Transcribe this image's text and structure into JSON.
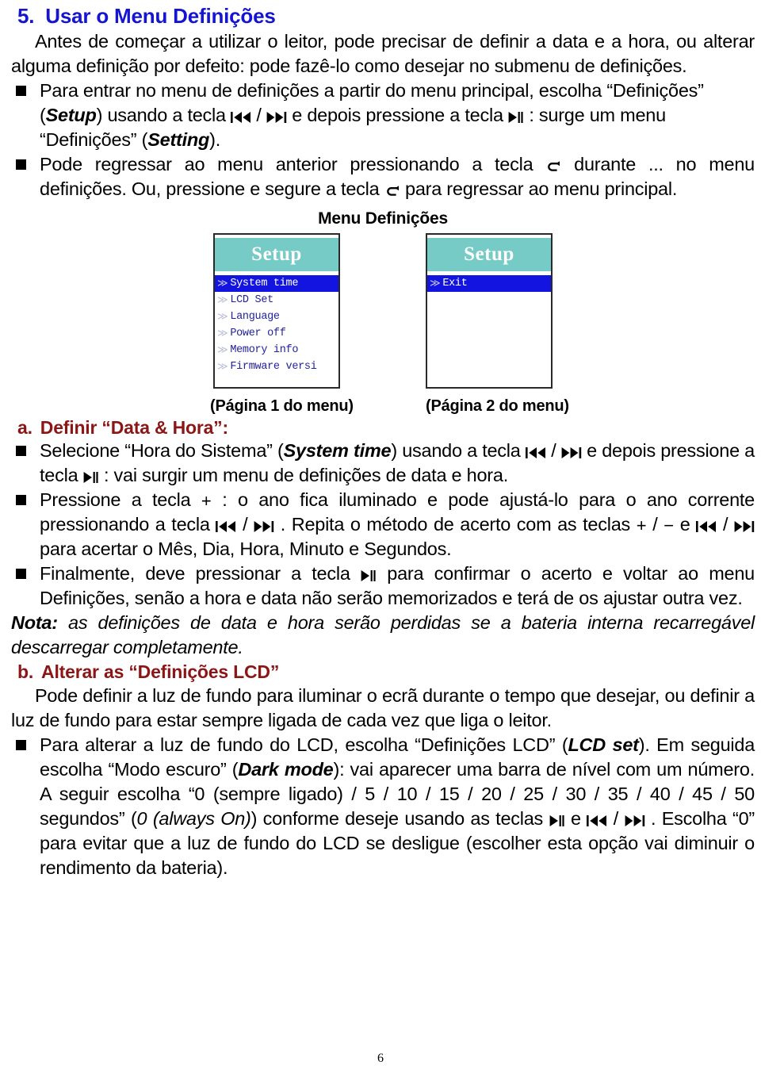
{
  "document": {
    "page_number": "6",
    "language": "pt-PT"
  },
  "section": {
    "number": "5.",
    "title": "Usar o Menu Definições",
    "color": "#1414d2",
    "intro": "Antes de começar a utilizar o leitor, pode precisar de definir a data e a hora, ou alterar alguma definição por defeito: pode fazê-lo como desejar no submenu de definições."
  },
  "bullets_intro": [
    {
      "id": "enter-setup-menu",
      "parts": [
        {
          "t": "text",
          "v": "Para entrar no menu de definições a partir do menu principal, escolha “Definições” ("
        },
        {
          "t": "bold-italic",
          "v": "Setup"
        },
        {
          "t": "text",
          "v": ") usando a tecla "
        },
        {
          "t": "key",
          "v": "prev-track"
        },
        {
          "t": "text",
          "v": " / "
        },
        {
          "t": "key",
          "v": "next-track"
        },
        {
          "t": "text",
          "v": " e depois pressione a tecla "
        },
        {
          "t": "key",
          "v": "play-pause"
        },
        {
          "t": "text",
          "v": " : surge um menu “Definições” ("
        },
        {
          "t": "bold-italic",
          "v": "Setting"
        },
        {
          "t": "text",
          "v": ")."
        }
      ]
    },
    {
      "id": "return-previous-menu",
      "parts": [
        {
          "t": "text",
          "v": "Pode regressar ao menu anterior pressionando a tecla "
        },
        {
          "t": "key",
          "v": "return-arrow"
        },
        {
          "t": "text",
          "v": " durante ... no menu definições. Ou, pressione e segure a tecla "
        },
        {
          "t": "key",
          "v": "return-arrow"
        },
        {
          "t": "text",
          "v": " para regressar ao menu principal."
        }
      ]
    }
  ],
  "figure": {
    "title": "Menu Definições",
    "screens": [
      {
        "header": "Setup",
        "caption": "(Página 1 do menu)",
        "items": [
          {
            "label": "System time",
            "selected": true
          },
          {
            "label": "LCD Set",
            "selected": false
          },
          {
            "label": "Language",
            "selected": false
          },
          {
            "label": "Power off",
            "selected": false
          },
          {
            "label": "Memory info",
            "selected": false
          },
          {
            "label": "Firmware versi",
            "selected": false
          }
        ]
      },
      {
        "header": "Setup",
        "caption": "(Página 2 do menu)",
        "items": [
          {
            "label": "Exit",
            "selected": true
          }
        ]
      }
    ],
    "colors": {
      "header_bg": "#76cbc6",
      "selected_bg": "#1414e0",
      "item_text": "#22229b",
      "border": "#2a2a2a"
    }
  },
  "subsection_a": {
    "number": "a.",
    "title": "Definir “Data & Hora”:",
    "color": "#8c1515",
    "bullets": [
      {
        "id": "select-system-time",
        "parts": [
          {
            "t": "text",
            "v": "Selecione “Hora do Sistema” ("
          },
          {
            "t": "bold-italic",
            "v": "System time"
          },
          {
            "t": "text",
            "v": ") usando a tecla "
          },
          {
            "t": "key",
            "v": "prev-track"
          },
          {
            "t": "text",
            "v": " / "
          },
          {
            "t": "key",
            "v": "next-track"
          },
          {
            "t": "text",
            "v": " e depois pressione a tecla "
          },
          {
            "t": "key",
            "v": "play-pause"
          },
          {
            "t": "text",
            "v": " : vai surgir um menu de definições de data e hora."
          }
        ]
      },
      {
        "id": "adjust-year",
        "parts": [
          {
            "t": "text",
            "v": "Pressione a tecla "
          },
          {
            "t": "key",
            "v": "plus"
          },
          {
            "t": "text",
            "v": " : o ano fica iluminado e pode ajustá-lo para o ano corrente pressionando a tecla "
          },
          {
            "t": "key",
            "v": "prev-track"
          },
          {
            "t": "text",
            "v": " / "
          },
          {
            "t": "key",
            "v": "next-track"
          },
          {
            "t": "text",
            "v": " . Repita o método de acerto com as teclas "
          },
          {
            "t": "key",
            "v": "plus"
          },
          {
            "t": "text",
            "v": " / "
          },
          {
            "t": "key",
            "v": "minus"
          },
          {
            "t": "text",
            "v": " e "
          },
          {
            "t": "key",
            "v": "prev-track"
          },
          {
            "t": "text",
            "v": " / "
          },
          {
            "t": "key",
            "v": "next-track"
          },
          {
            "t": "text",
            "v": " para acertar o Mês, Dia, Hora, Minuto e Segundos."
          }
        ]
      },
      {
        "id": "confirm-and-return",
        "parts": [
          {
            "t": "text",
            "v": "Finalmente, deve pressionar a tecla "
          },
          {
            "t": "key",
            "v": "play-pause"
          },
          {
            "t": "text",
            "v": " para confirmar o acerto e voltar ao menu Definições, senão a hora e data não serão memorizados e terá de os ajustar outra vez."
          }
        ]
      }
    ],
    "note_label": "Nota:",
    "note_text": " as definições de data e hora serão perdidas se a bateria interna recarregável descarregar completamente."
  },
  "subsection_b": {
    "number": "b.",
    "title": "Alterar as “Definições LCD”",
    "color": "#8c1515",
    "intro": "Pode definir a luz de fundo para iluminar o ecrã durante o tempo que desejar, ou definir a luz de fundo para estar sempre ligada de cada vez que liga o leitor.",
    "bullets": [
      {
        "id": "change-lcd-backlight",
        "parts": [
          {
            "t": "text",
            "v": "Para alterar a luz de fundo do LCD, escolha “Definições LCD” ("
          },
          {
            "t": "bold-italic",
            "v": "LCD set"
          },
          {
            "t": "text",
            "v": "). Em seguida escolha “Modo escuro” ("
          },
          {
            "t": "bold-italic",
            "v": "Dark mode"
          },
          {
            "t": "text",
            "v": "): vai aparecer uma barra de nível com um número. A seguir escolha “0 (sempre ligado) / 5 / 10 / 15 / 20 / 25 / 30 / 35 / 40 / 45 / 50 segundos” ("
          },
          {
            "t": "italic",
            "v": "0 (always On)"
          },
          {
            "t": "text",
            "v": ") conforme deseje usando as teclas "
          },
          {
            "t": "key",
            "v": "play-pause"
          },
          {
            "t": "text",
            "v": " e "
          },
          {
            "t": "key",
            "v": "prev-track"
          },
          {
            "t": "text",
            "v": " / "
          },
          {
            "t": "key",
            "v": "next-track"
          },
          {
            "t": "text",
            "v": " . Escolha “0” para evitar que a luz de fundo do LCD se desligue (escolher esta opção vai diminuir o rendimento da bateria)."
          }
        ]
      }
    ]
  },
  "backlight_options": [
    "0 (sempre ligado)",
    "5",
    "10",
    "15",
    "20",
    "25",
    "30",
    "35",
    "40",
    "45",
    "50"
  ],
  "keys": {
    "prev-track": "⏮",
    "next-track": "⏭",
    "play-pause": "⏯",
    "return-arrow": "⮌",
    "plus": "+",
    "minus": "−"
  }
}
